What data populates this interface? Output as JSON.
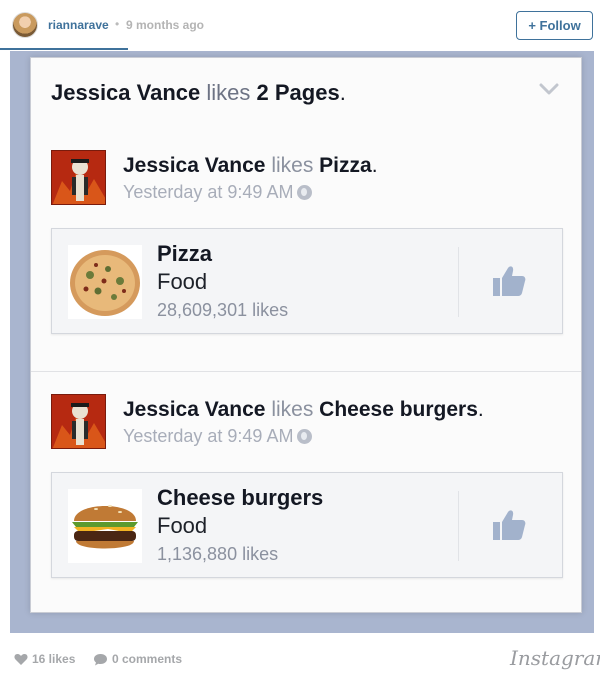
{
  "header": {
    "username": "riannarave",
    "separator": "•",
    "time_ago": "9 months ago",
    "follow_label": "+ Follow"
  },
  "story": {
    "actor": "Jessica Vance",
    "verb": "likes",
    "object": "2 Pages",
    "punct": ".",
    "entries": [
      {
        "actor": "Jessica Vance",
        "verb": "likes",
        "object": "Pizza",
        "punct": ".",
        "timestamp": "Yesterday at 9:49 AM",
        "page": {
          "name": "Pizza",
          "category": "Food",
          "likes": "28,609,301 likes"
        }
      },
      {
        "actor": "Jessica Vance",
        "verb": "likes",
        "object": "Cheese burgers",
        "punct": ".",
        "timestamp": "Yesterday at 9:49 AM",
        "page": {
          "name": "Cheese burgers",
          "category": "Food",
          "likes": "1,136,880 likes"
        }
      }
    ]
  },
  "footer": {
    "likes": "16 likes",
    "comments": "0 comments",
    "brand": "Instagram"
  },
  "icons": {
    "chevron": "chevron-down-icon",
    "globe": "globe-icon",
    "thumb": "thumbs-up-icon",
    "heart": "heart-icon",
    "comment": "comment-icon"
  },
  "colors": {
    "ig_blue": "#3f729b",
    "fb_like": "#a2b2cc",
    "frame": "#a9b5cf"
  }
}
